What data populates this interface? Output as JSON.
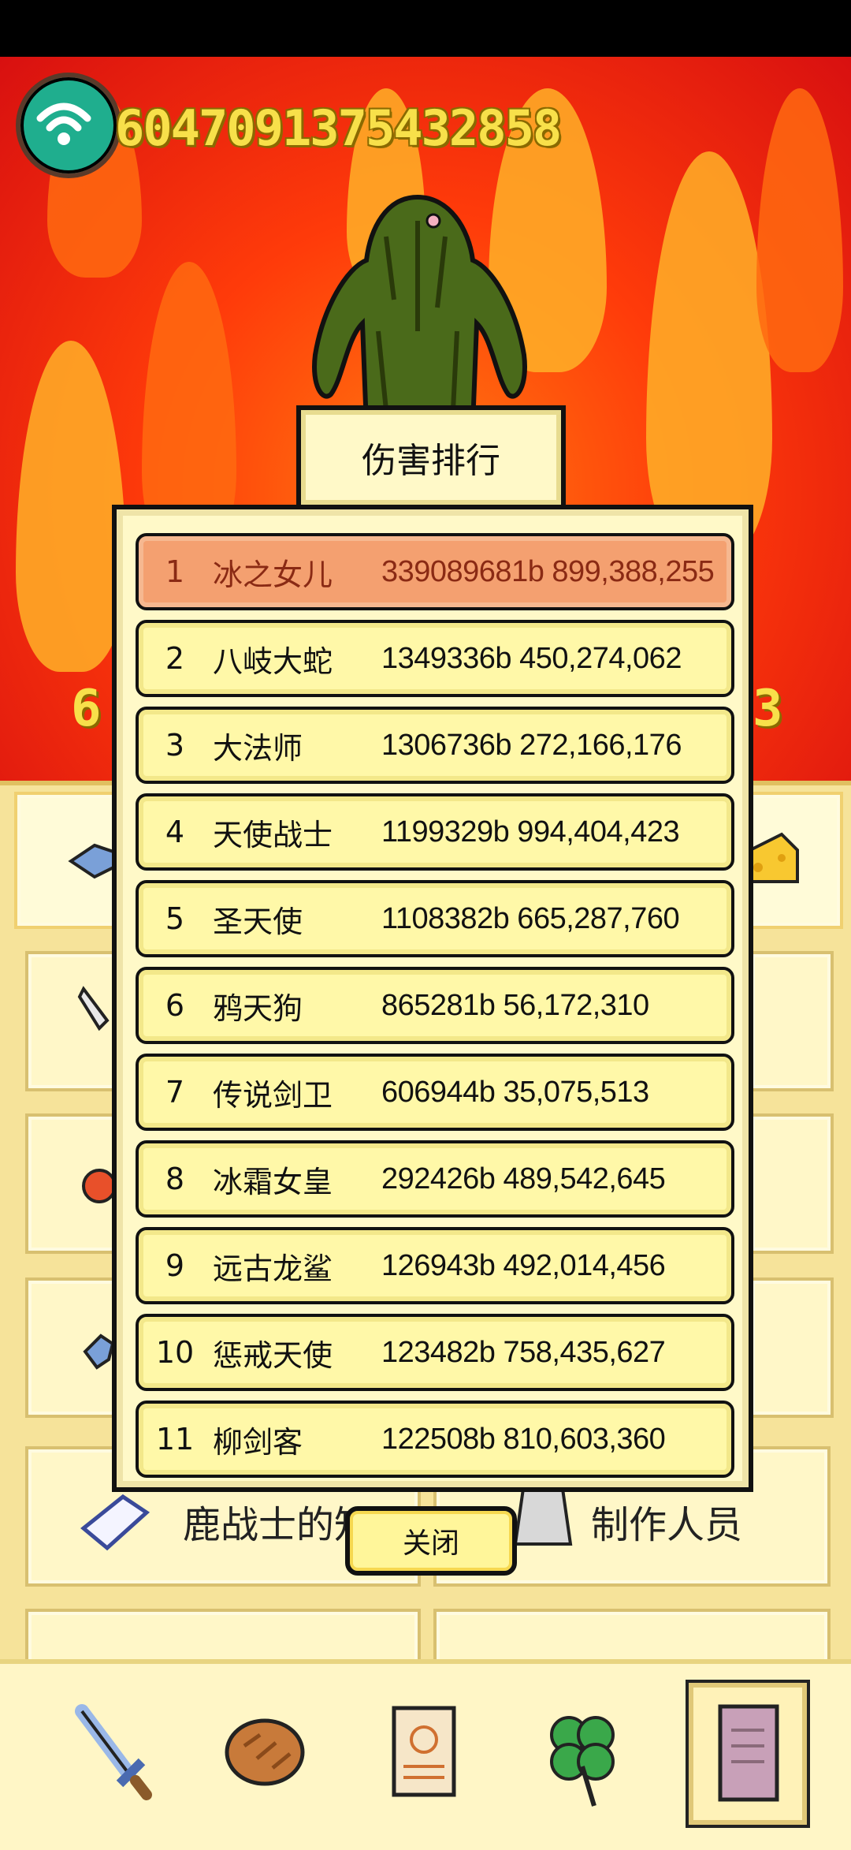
{
  "hud": {
    "gold_amount": "604709137543285​8"
  },
  "scene": {
    "side_number_left": "6",
    "side_number_right": "3"
  },
  "modal": {
    "title": "伤害排行",
    "close_label": "关闭",
    "rows": [
      {
        "rank": "1",
        "name": "冰之女儿",
        "score": "339089681b 899,388,255"
      },
      {
        "rank": "2",
        "name": "八岐大蛇",
        "score": "1349336b 450,274,062"
      },
      {
        "rank": "3",
        "name": "大法师",
        "score": "1306736b 272,166,176"
      },
      {
        "rank": "4",
        "name": "天使战士",
        "score": "1199329b 994,404,423"
      },
      {
        "rank": "5",
        "name": "圣天使",
        "score": "1108382b 665,287,760"
      },
      {
        "rank": "6",
        "name": "鸦天狗",
        "score": "865281b 56,172,310"
      },
      {
        "rank": "7",
        "name": "传说剑卫",
        "score": "606944b 35,075,513"
      },
      {
        "rank": "8",
        "name": "冰霜女皇",
        "score": "292426b 489,542,645"
      },
      {
        "rank": "9",
        "name": "远古龙鲨",
        "score": "126943b 492,014,456"
      },
      {
        "rank": "10",
        "name": "惩戒天使",
        "score": "123482b 758,435,627"
      },
      {
        "rank": "11",
        "name": "柳剑客",
        "score": "122508b 810,603,360"
      }
    ]
  },
  "panel": {
    "left_item_label": "鹿战士的知",
    "right_item_label": "制作人员"
  },
  "bottom_tabs": [
    {
      "icon": "sword-icon"
    },
    {
      "icon": "bread-icon"
    },
    {
      "icon": "scroll-icon"
    },
    {
      "icon": "clover-icon"
    },
    {
      "icon": "book-icon"
    }
  ]
}
